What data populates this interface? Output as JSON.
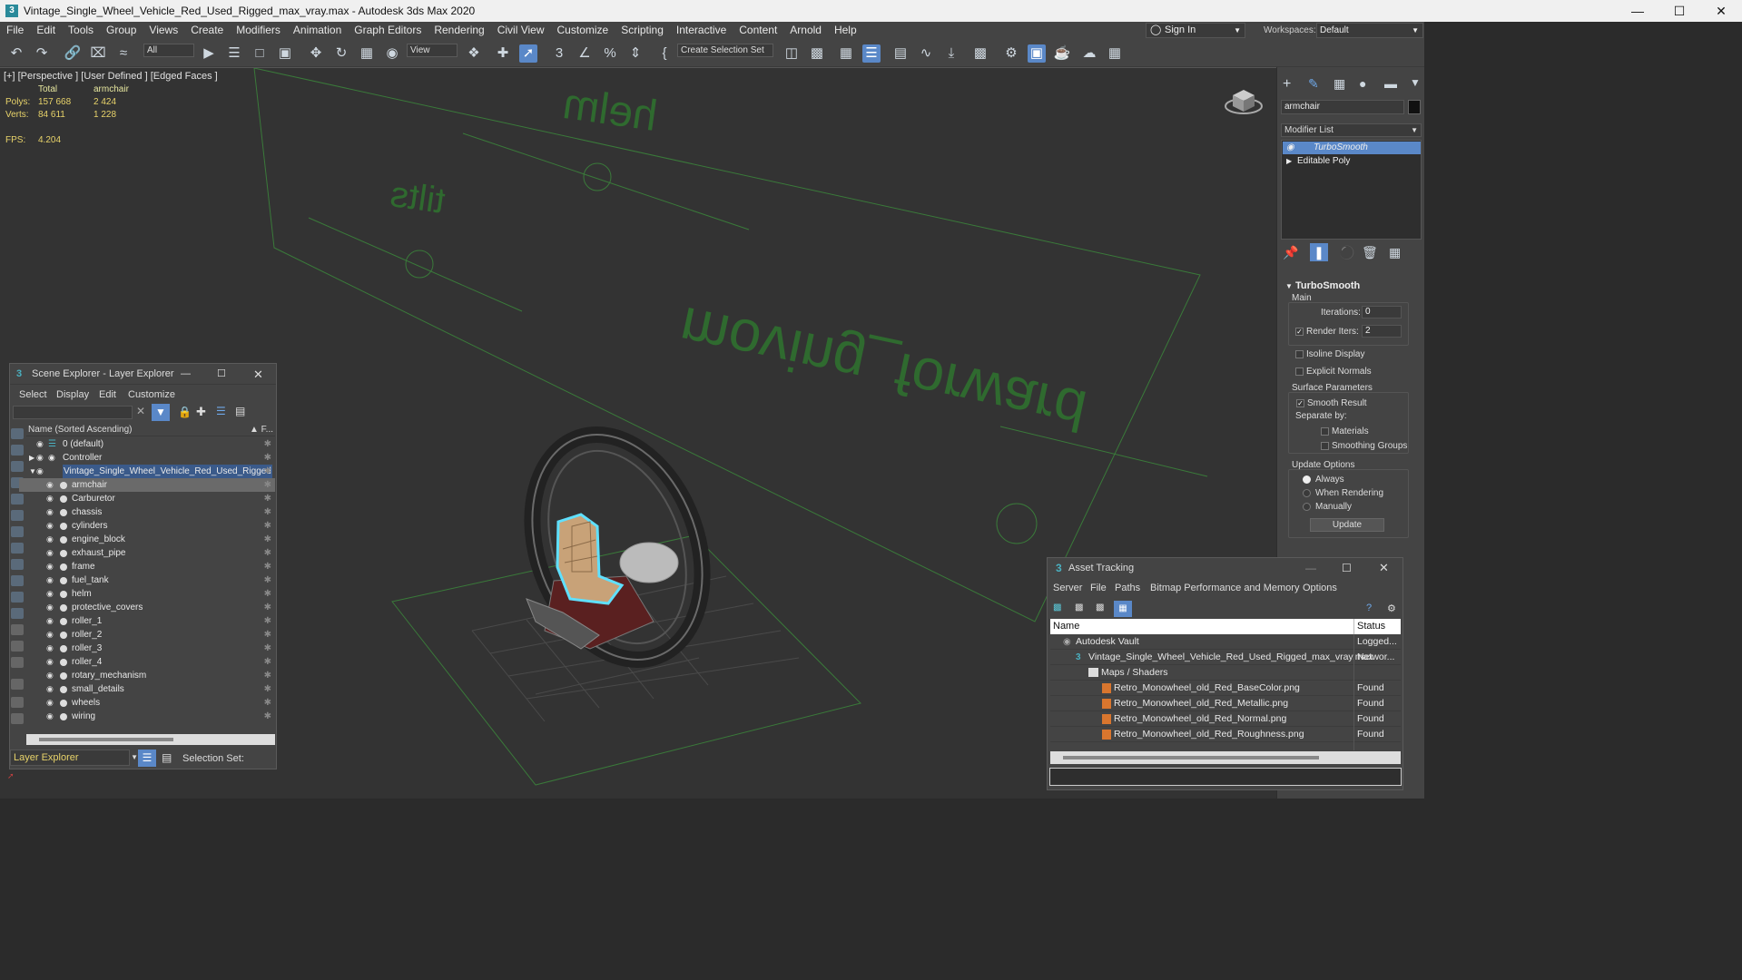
{
  "title": "Vintage_Single_Wheel_Vehicle_Red_Used_Rigged_max_vray.max - Autodesk 3ds Max 2020",
  "menu": [
    "File",
    "Edit",
    "Tools",
    "Group",
    "Views",
    "Create",
    "Modifiers",
    "Animation",
    "Graph Editors",
    "Rendering",
    "Civil View",
    "Customize",
    "Scripting",
    "Interactive",
    "Content",
    "Arnold",
    "Help"
  ],
  "sign_in": "Sign In",
  "workspaces_label": "Workspaces:",
  "workspace_value": "Default",
  "toolbar": {
    "filter": "All",
    "ref_coord": "View",
    "selection_set": "Create Selection Set"
  },
  "viewport": {
    "label": "[+] [Perspective ] [User Defined ] [Edged Faces ]",
    "stats_header_total": "Total",
    "stats_header_obj": "armchair",
    "polys_label": "Polys:",
    "polys_total": "157 668",
    "polys_obj": "2 424",
    "verts_label": "Verts:",
    "verts_total": "84 611",
    "verts_obj": "1 228",
    "fps_label": "FPS:",
    "fps_value": "4.204",
    "text_helm": "helm",
    "text_tilts": "tilts",
    "text_moving": "moving_forward"
  },
  "command_panel": {
    "object_name": "armchair",
    "modifier_list": "Modifier List",
    "stack": [
      "TurboSmooth",
      "Editable Poly"
    ],
    "rollout_title": "TurboSmooth",
    "main": "Main",
    "iterations_label": "Iterations:",
    "iterations_value": "0",
    "render_iters_label": "Render Iters:",
    "render_iters_value": "2",
    "isoline": "Isoline Display",
    "explicit_normals": "Explicit Normals",
    "surface_params": "Surface Parameters",
    "smooth_result": "Smooth Result",
    "separate_by": "Separate by:",
    "materials": "Materials",
    "smoothing_groups": "Smoothing Groups",
    "update_options": "Update Options",
    "always": "Always",
    "when_rendering": "When Rendering",
    "manually": "Manually",
    "update_btn": "Update"
  },
  "scene_explorer": {
    "title": "Scene Explorer - Layer Explorer",
    "menu": [
      "Select",
      "Display",
      "Edit",
      "Customize"
    ],
    "col_name": "Name (Sorted Ascending)",
    "col_frozen": "▲ F...",
    "rows": [
      {
        "name": "0 (default)",
        "level": 0
      },
      {
        "name": "Controller",
        "level": 0
      },
      {
        "name": "Vintage_Single_Wheel_Vehicle_Red_Used_Rigged",
        "level": 0
      },
      {
        "name": "armchair",
        "level": 1
      },
      {
        "name": "Carburetor",
        "level": 1
      },
      {
        "name": "chassis",
        "level": 1
      },
      {
        "name": "cylinders",
        "level": 1
      },
      {
        "name": "engine_block",
        "level": 1
      },
      {
        "name": "exhaust_pipe",
        "level": 1
      },
      {
        "name": "frame",
        "level": 1
      },
      {
        "name": "fuel_tank",
        "level": 1
      },
      {
        "name": "helm",
        "level": 1
      },
      {
        "name": "protective_covers",
        "level": 1
      },
      {
        "name": "roller_1",
        "level": 1
      },
      {
        "name": "roller_2",
        "level": 1
      },
      {
        "name": "roller_3",
        "level": 1
      },
      {
        "name": "roller_4",
        "level": 1
      },
      {
        "name": "rotary_mechanism",
        "level": 1
      },
      {
        "name": "small_details",
        "level": 1
      },
      {
        "name": "wheels",
        "level": 1
      },
      {
        "name": "wiring",
        "level": 1
      }
    ],
    "footer_explorer": "Layer Explorer",
    "footer_selset": "Selection Set:"
  },
  "asset_tracking": {
    "title": "Asset Tracking",
    "menu": [
      "Server",
      "File",
      "Paths",
      "Bitmap Performance and Memory",
      "Options"
    ],
    "col_name": "Name",
    "col_status": "Status",
    "rows": [
      {
        "name": "Autodesk Vault",
        "status": "Logged..."
      },
      {
        "name": "Vintage_Single_Wheel_Vehicle_Red_Used_Rigged_max_vray.max",
        "status": "Networ..."
      },
      {
        "name": "Maps / Shaders",
        "status": ""
      },
      {
        "name": "Retro_Monowheel_old_Red_BaseColor.png",
        "status": "Found"
      },
      {
        "name": "Retro_Monowheel_old_Red_Metallic.png",
        "status": "Found"
      },
      {
        "name": "Retro_Monowheel_old_Red_Normal.png",
        "status": "Found"
      },
      {
        "name": "Retro_Monowheel_old_Red_Roughness.png",
        "status": "Found"
      }
    ]
  }
}
